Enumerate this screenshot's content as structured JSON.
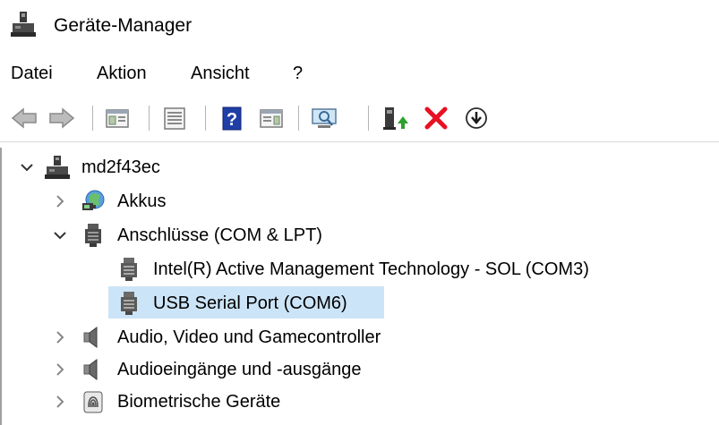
{
  "window": {
    "title": "Geräte-Manager",
    "app_icon": "device-manager-icon"
  },
  "menu": {
    "items": [
      {
        "label": "Datei"
      },
      {
        "label": "Aktion"
      },
      {
        "label": "Ansicht"
      },
      {
        "label": "?"
      }
    ]
  },
  "toolbar": {
    "buttons": [
      {
        "icon": "back-arrow-icon"
      },
      {
        "icon": "forward-arrow-icon"
      },
      {
        "icon": "show-hide-console-tree-icon"
      },
      {
        "icon": "properties-icon"
      },
      {
        "icon": "help-icon"
      },
      {
        "icon": "action-pane-icon"
      },
      {
        "icon": "scan-hardware-changes-icon"
      },
      {
        "icon": "update-driver-icon"
      },
      {
        "icon": "uninstall-device-icon"
      },
      {
        "icon": "disable-device-icon"
      }
    ]
  },
  "tree": {
    "root": {
      "label": "md2f43ec",
      "expanded": true,
      "icon": "computer-icon"
    },
    "items": [
      {
        "label": "Akkus",
        "expanded": false,
        "icon": "battery-icon"
      },
      {
        "label": "Anschlüsse (COM & LPT)",
        "expanded": true,
        "icon": "port-icon"
      },
      {
        "label": "Intel(R) Active Management Technology - SOL (COM3)",
        "child": true,
        "icon": "port-icon"
      },
      {
        "label": "USB Serial Port (COM6)",
        "child": true,
        "selected": true,
        "icon": "port-icon"
      },
      {
        "label": "Audio, Video und Gamecontroller",
        "expanded": false,
        "icon": "speaker-icon"
      },
      {
        "label": "Audioeingänge und -ausgänge",
        "expanded": false,
        "icon": "speaker-icon"
      },
      {
        "label": "Biometrische Geräte",
        "expanded": false,
        "icon": "fingerprint-icon"
      }
    ]
  },
  "colors": {
    "selection": "#cce4f7",
    "uninstall_red": "#e81123",
    "update_green": "#2ca02c",
    "help_blue": "#1f3fa6"
  }
}
